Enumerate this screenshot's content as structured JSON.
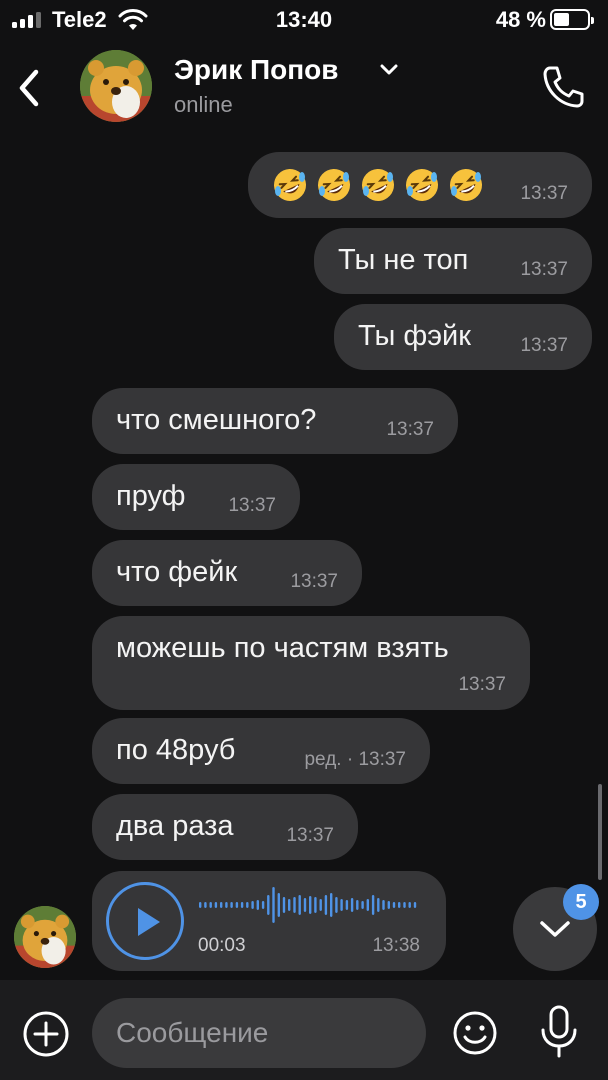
{
  "status": {
    "carrier": "Tele2",
    "time": "13:40",
    "battery": "48 %",
    "battery_level": 0.48
  },
  "header": {
    "contact_name": "Эрик Попов",
    "presence": "online"
  },
  "messages": {
    "outgoing": [
      {
        "kind": "emoji",
        "emoji": "rolling-on-floor-laughing",
        "count": 5,
        "time": "13:37"
      },
      {
        "text": "Ты не топ",
        "time": "13:37"
      },
      {
        "text": "Ты фэйк",
        "time": "13:37"
      }
    ],
    "incoming": [
      {
        "text": "что смешного?",
        "time": "13:37"
      },
      {
        "text": "пруф",
        "time": "13:37"
      },
      {
        "text": "что фейк",
        "time": "13:37"
      },
      {
        "text": "можешь по частям взять",
        "time": "13:37"
      },
      {
        "text": "по 48руб",
        "edited": "ред. · 13:37"
      },
      {
        "text": "два раза",
        "time": "13:37"
      }
    ],
    "voice": {
      "duration": "00:03",
      "time": "13:38"
    }
  },
  "scroll_down": {
    "unread_count": "5"
  },
  "composer": {
    "placeholder": "Сообщение"
  },
  "colors": {
    "accent": "#4f93e6",
    "bubble": "#363638",
    "background": "#111112"
  }
}
